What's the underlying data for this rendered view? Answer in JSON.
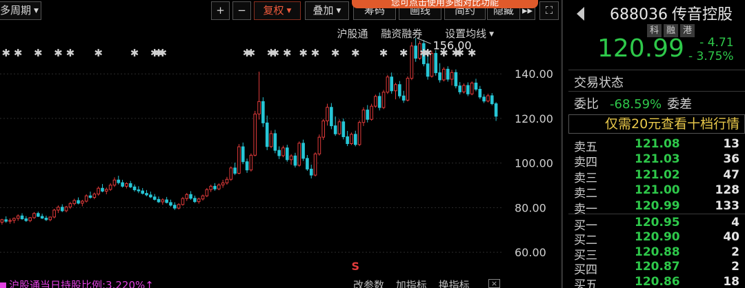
{
  "toolbar": {
    "period_label": "多周期",
    "zoom_in": "+",
    "zoom_out": "−",
    "adjust_label": "复权",
    "overlay_label": "叠加",
    "tooltip_text": "您可点击使用多图对比功能",
    "chip_label": "筹码",
    "draw_label": "画线",
    "simple_label": "简约",
    "hide_label": "隐藏",
    "more_label": "▸▸",
    "fullscreen_label": "⛶"
  },
  "sub_toolbar": {
    "hgt_label": "沪股通",
    "margin_label": "融资融券",
    "ma_label": "设置均线"
  },
  "indicator": {
    "label": "沪股通当日持股比例:3.220%",
    "arrow": "↑"
  },
  "bottom_actions": {
    "param_label": "改参数",
    "add_label": "加指标",
    "switch_label": "换指标",
    "close_label": "×"
  },
  "quote": {
    "code": "688036",
    "name": "传音控股",
    "badges": [
      "科",
      "融",
      "港"
    ],
    "last_price": "120.99",
    "change": "- 4.71",
    "change_pct": "- 3.75%",
    "status_label": "交易状态",
    "weibi_label": "委比",
    "weibi_value": "-68.59%",
    "weicha_label": "委差",
    "promo_text": "仅需20元查看十档行情"
  },
  "order_book": {
    "asks": [
      {
        "label": "卖五",
        "price": "121.08",
        "volume": "13"
      },
      {
        "label": "卖四",
        "price": "121.03",
        "volume": "36"
      },
      {
        "label": "卖三",
        "price": "121.02",
        "volume": "47"
      },
      {
        "label": "卖二",
        "price": "121.00",
        "volume": "128"
      },
      {
        "label": "卖一",
        "price": "120.99",
        "volume": "133"
      }
    ],
    "bids": [
      {
        "label": "买一",
        "price": "120.95",
        "volume": "4"
      },
      {
        "label": "买二",
        "price": "120.90",
        "volume": "40"
      },
      {
        "label": "买三",
        "price": "120.88",
        "volume": "2"
      },
      {
        "label": "买四",
        "price": "120.87",
        "volume": "2"
      },
      {
        "label": "买五",
        "price": "120.86",
        "volume": "18"
      }
    ]
  },
  "chart_data": {
    "type": "candlestick",
    "y_ticks": [
      "140.00",
      "120.00",
      "100.00",
      "80.00",
      "60.00"
    ],
    "y_tick_values": [
      140,
      120,
      100,
      80,
      60
    ],
    "ylim": [
      52,
      162
    ],
    "max_annotation": {
      "label": "156.00",
      "value": 156
    },
    "event_marker": "S",
    "colors": {
      "up": "#e23b3b",
      "down": "#27c6d6",
      "marker": "#d0d0d0"
    },
    "candles": [
      {
        "o": 73.5,
        "h": 75.0,
        "l": 72.4,
        "c": 74.6
      },
      {
        "o": 74.6,
        "h": 76.1,
        "l": 73.2,
        "c": 73.9
      },
      {
        "o": 73.9,
        "h": 75.2,
        "l": 72.8,
        "c": 74.3
      },
      {
        "o": 74.3,
        "h": 75.6,
        "l": 73.0,
        "c": 75.2
      },
      {
        "o": 75.2,
        "h": 77.0,
        "l": 74.1,
        "c": 76.3
      },
      {
        "o": 76.3,
        "h": 77.5,
        "l": 74.5,
        "c": 75.0
      },
      {
        "o": 75.0,
        "h": 76.2,
        "l": 73.6,
        "c": 74.2
      },
      {
        "o": 74.2,
        "h": 75.8,
        "l": 73.5,
        "c": 75.5
      },
      {
        "o": 75.5,
        "h": 78.0,
        "l": 75.0,
        "c": 77.4
      },
      {
        "o": 77.4,
        "h": 78.2,
        "l": 75.8,
        "c": 76.1
      },
      {
        "o": 76.1,
        "h": 77.3,
        "l": 74.9,
        "c": 75.3
      },
      {
        "o": 75.3,
        "h": 76.4,
        "l": 74.0,
        "c": 74.6
      },
      {
        "o": 74.6,
        "h": 76.0,
        "l": 73.9,
        "c": 75.8
      },
      {
        "o": 75.8,
        "h": 79.5,
        "l": 75.2,
        "c": 78.9
      },
      {
        "o": 78.9,
        "h": 81.0,
        "l": 77.6,
        "c": 80.2
      },
      {
        "o": 80.2,
        "h": 81.5,
        "l": 78.0,
        "c": 78.6
      },
      {
        "o": 78.6,
        "h": 80.8,
        "l": 77.9,
        "c": 80.3
      },
      {
        "o": 80.3,
        "h": 82.6,
        "l": 79.4,
        "c": 81.8
      },
      {
        "o": 81.8,
        "h": 84.0,
        "l": 81.0,
        "c": 83.2
      },
      {
        "o": 83.2,
        "h": 84.6,
        "l": 81.5,
        "c": 82.0
      },
      {
        "o": 82.0,
        "h": 83.5,
        "l": 80.6,
        "c": 82.9
      },
      {
        "o": 82.9,
        "h": 86.0,
        "l": 82.3,
        "c": 85.3
      },
      {
        "o": 85.3,
        "h": 87.2,
        "l": 84.0,
        "c": 84.6
      },
      {
        "o": 84.6,
        "h": 86.8,
        "l": 83.8,
        "c": 86.1
      },
      {
        "o": 86.1,
        "h": 89.5,
        "l": 85.4,
        "c": 88.7
      },
      {
        "o": 88.7,
        "h": 90.6,
        "l": 86.9,
        "c": 87.4
      },
      {
        "o": 87.4,
        "h": 89.0,
        "l": 86.0,
        "c": 88.2
      },
      {
        "o": 88.2,
        "h": 91.0,
        "l": 87.5,
        "c": 90.1
      },
      {
        "o": 90.1,
        "h": 93.6,
        "l": 89.3,
        "c": 92.4
      },
      {
        "o": 92.4,
        "h": 94.3,
        "l": 90.4,
        "c": 91.2
      },
      {
        "o": 91.2,
        "h": 92.5,
        "l": 89.0,
        "c": 89.6
      },
      {
        "o": 89.6,
        "h": 91.4,
        "l": 88.6,
        "c": 90.8
      },
      {
        "o": 90.8,
        "h": 92.0,
        "l": 88.8,
        "c": 89.3
      },
      {
        "o": 89.3,
        "h": 90.4,
        "l": 87.2,
        "c": 88.0
      },
      {
        "o": 88.0,
        "h": 89.6,
        "l": 86.5,
        "c": 87.5
      },
      {
        "o": 87.5,
        "h": 88.8,
        "l": 85.9,
        "c": 86.4
      },
      {
        "o": 86.4,
        "h": 87.9,
        "l": 85.1,
        "c": 85.7
      },
      {
        "o": 85.7,
        "h": 87.2,
        "l": 84.3,
        "c": 84.8
      },
      {
        "o": 84.8,
        "h": 86.1,
        "l": 83.2,
        "c": 83.7
      },
      {
        "o": 83.7,
        "h": 85.0,
        "l": 82.1,
        "c": 82.6
      },
      {
        "o": 82.6,
        "h": 84.2,
        "l": 81.3,
        "c": 83.5
      },
      {
        "o": 83.5,
        "h": 84.8,
        "l": 81.9,
        "c": 82.3
      },
      {
        "o": 82.3,
        "h": 83.6,
        "l": 80.5,
        "c": 81.1
      },
      {
        "o": 81.1,
        "h": 82.4,
        "l": 79.0,
        "c": 79.8
      },
      {
        "o": 79.8,
        "h": 82.0,
        "l": 79.2,
        "c": 81.4
      },
      {
        "o": 81.4,
        "h": 84.8,
        "l": 80.9,
        "c": 84.1
      },
      {
        "o": 84.1,
        "h": 86.6,
        "l": 83.0,
        "c": 85.9
      },
      {
        "o": 85.9,
        "h": 87.4,
        "l": 83.5,
        "c": 84.2
      },
      {
        "o": 84.2,
        "h": 85.4,
        "l": 82.1,
        "c": 82.7
      },
      {
        "o": 82.7,
        "h": 84.5,
        "l": 81.8,
        "c": 83.9
      },
      {
        "o": 83.9,
        "h": 85.9,
        "l": 83.2,
        "c": 85.3
      },
      {
        "o": 85.3,
        "h": 88.8,
        "l": 84.7,
        "c": 88.1
      },
      {
        "o": 88.1,
        "h": 90.3,
        "l": 87.0,
        "c": 89.6
      },
      {
        "o": 89.6,
        "h": 91.0,
        "l": 87.6,
        "c": 88.4
      },
      {
        "o": 88.4,
        "h": 90.9,
        "l": 87.8,
        "c": 90.2
      },
      {
        "o": 90.2,
        "h": 92.5,
        "l": 88.9,
        "c": 91.1
      },
      {
        "o": 91.1,
        "h": 93.8,
        "l": 90.3,
        "c": 92.7
      },
      {
        "o": 92.7,
        "h": 98.5,
        "l": 92.0,
        "c": 97.8
      },
      {
        "o": 97.8,
        "h": 100.2,
        "l": 94.6,
        "c": 95.4
      },
      {
        "o": 95.4,
        "h": 108.5,
        "l": 95.0,
        "c": 107.3
      },
      {
        "o": 107.3,
        "h": 109.2,
        "l": 99.5,
        "c": 100.6
      },
      {
        "o": 100.6,
        "h": 102.0,
        "l": 95.6,
        "c": 96.9
      },
      {
        "o": 96.9,
        "h": 104.3,
        "l": 96.2,
        "c": 103.5
      },
      {
        "o": 103.5,
        "h": 123.4,
        "l": 103.0,
        "c": 122.0
      },
      {
        "o": 122.0,
        "h": 141.0,
        "l": 119.5,
        "c": 127.6
      },
      {
        "o": 127.6,
        "h": 129.5,
        "l": 116.2,
        "c": 118.0
      },
      {
        "o": 118.0,
        "h": 121.3,
        "l": 105.8,
        "c": 107.4
      },
      {
        "o": 107.4,
        "h": 114.6,
        "l": 106.7,
        "c": 113.2
      },
      {
        "o": 113.2,
        "h": 114.9,
        "l": 104.4,
        "c": 105.7
      },
      {
        "o": 105.7,
        "h": 107.5,
        "l": 101.8,
        "c": 103.3
      },
      {
        "o": 103.3,
        "h": 107.8,
        "l": 102.6,
        "c": 106.8
      },
      {
        "o": 106.8,
        "h": 108.2,
        "l": 100.6,
        "c": 101.5
      },
      {
        "o": 101.5,
        "h": 104.0,
        "l": 99.2,
        "c": 103.2
      },
      {
        "o": 103.2,
        "h": 104.6,
        "l": 98.0,
        "c": 99.0
      },
      {
        "o": 99.0,
        "h": 109.7,
        "l": 98.4,
        "c": 108.9
      },
      {
        "o": 108.9,
        "h": 110.5,
        "l": 100.9,
        "c": 102.1
      },
      {
        "o": 102.1,
        "h": 103.6,
        "l": 96.5,
        "c": 97.3
      },
      {
        "o": 97.3,
        "h": 99.3,
        "l": 93.1,
        "c": 94.6
      },
      {
        "o": 94.6,
        "h": 104.8,
        "l": 94.0,
        "c": 104.1
      },
      {
        "o": 104.1,
        "h": 112.8,
        "l": 103.3,
        "c": 111.6
      },
      {
        "o": 111.6,
        "h": 119.8,
        "l": 110.4,
        "c": 118.9
      },
      {
        "o": 118.9,
        "h": 126.6,
        "l": 116.8,
        "c": 125.0
      },
      {
        "o": 125.0,
        "h": 126.9,
        "l": 115.2,
        "c": 116.7
      },
      {
        "o": 116.7,
        "h": 120.9,
        "l": 112.2,
        "c": 113.1
      },
      {
        "o": 113.1,
        "h": 119.6,
        "l": 112.5,
        "c": 118.5
      },
      {
        "o": 118.5,
        "h": 120.0,
        "l": 110.6,
        "c": 111.8
      },
      {
        "o": 111.8,
        "h": 114.4,
        "l": 107.6,
        "c": 108.7
      },
      {
        "o": 108.7,
        "h": 113.7,
        "l": 108.1,
        "c": 112.9
      },
      {
        "o": 112.9,
        "h": 114.5,
        "l": 107.5,
        "c": 108.3
      },
      {
        "o": 108.3,
        "h": 119.1,
        "l": 107.6,
        "c": 118.2
      },
      {
        "o": 118.2,
        "h": 125.0,
        "l": 116.6,
        "c": 123.8
      },
      {
        "o": 123.8,
        "h": 126.0,
        "l": 118.2,
        "c": 119.6
      },
      {
        "o": 119.6,
        "h": 126.6,
        "l": 119.0,
        "c": 125.5
      },
      {
        "o": 125.5,
        "h": 130.7,
        "l": 124.8,
        "c": 129.9
      },
      {
        "o": 129.9,
        "h": 131.6,
        "l": 123.6,
        "c": 124.9
      },
      {
        "o": 124.9,
        "h": 132.8,
        "l": 124.2,
        "c": 131.8
      },
      {
        "o": 131.8,
        "h": 139.5,
        "l": 131.0,
        "c": 138.6
      },
      {
        "o": 138.6,
        "h": 140.6,
        "l": 131.1,
        "c": 132.4
      },
      {
        "o": 132.4,
        "h": 136.0,
        "l": 128.6,
        "c": 135.2
      },
      {
        "o": 135.2,
        "h": 136.8,
        "l": 129.0,
        "c": 130.1
      },
      {
        "o": 130.1,
        "h": 132.4,
        "l": 127.0,
        "c": 128.2
      },
      {
        "o": 128.2,
        "h": 138.9,
        "l": 127.6,
        "c": 138.0
      },
      {
        "o": 138.0,
        "h": 154.2,
        "l": 137.2,
        "c": 152.5
      },
      {
        "o": 152.5,
        "h": 156.0,
        "l": 145.4,
        "c": 147.0
      },
      {
        "o": 147.0,
        "h": 154.8,
        "l": 146.2,
        "c": 153.6
      },
      {
        "o": 153.6,
        "h": 155.2,
        "l": 143.4,
        "c": 144.5
      },
      {
        "o": 144.5,
        "h": 148.5,
        "l": 137.4,
        "c": 138.9
      },
      {
        "o": 138.9,
        "h": 150.4,
        "l": 138.3,
        "c": 149.2
      },
      {
        "o": 149.2,
        "h": 150.6,
        "l": 139.2,
        "c": 140.5
      },
      {
        "o": 140.5,
        "h": 144.8,
        "l": 136.1,
        "c": 137.3
      },
      {
        "o": 137.3,
        "h": 143.0,
        "l": 136.6,
        "c": 142.1
      },
      {
        "o": 142.1,
        "h": 143.4,
        "l": 136.5,
        "c": 137.6
      },
      {
        "o": 137.6,
        "h": 141.8,
        "l": 134.8,
        "c": 140.6
      },
      {
        "o": 140.6,
        "h": 142.0,
        "l": 133.5,
        "c": 134.6
      },
      {
        "o": 134.6,
        "h": 136.3,
        "l": 130.8,
        "c": 131.9
      },
      {
        "o": 131.9,
        "h": 135.7,
        "l": 131.2,
        "c": 134.8
      },
      {
        "o": 134.8,
        "h": 136.2,
        "l": 130.0,
        "c": 131.0
      },
      {
        "o": 131.0,
        "h": 136.6,
        "l": 130.4,
        "c": 135.9
      },
      {
        "o": 135.9,
        "h": 137.8,
        "l": 132.2,
        "c": 133.1
      },
      {
        "o": 133.1,
        "h": 134.6,
        "l": 128.7,
        "c": 129.6
      },
      {
        "o": 129.6,
        "h": 130.9,
        "l": 126.9,
        "c": 127.8
      },
      {
        "o": 127.8,
        "h": 131.1,
        "l": 127.2,
        "c": 130.2
      },
      {
        "o": 130.2,
        "h": 131.4,
        "l": 125.9,
        "c": 126.6
      },
      {
        "o": 126.6,
        "h": 127.3,
        "l": 118.9,
        "c": 120.99
      }
    ],
    "marker_candles": [
      1,
      4,
      9,
      14,
      17,
      24,
      33,
      38,
      39,
      40,
      61,
      62,
      67,
      68,
      71,
      75,
      78,
      83,
      88,
      95,
      100,
      105,
      106,
      110,
      113,
      114,
      117
    ]
  }
}
